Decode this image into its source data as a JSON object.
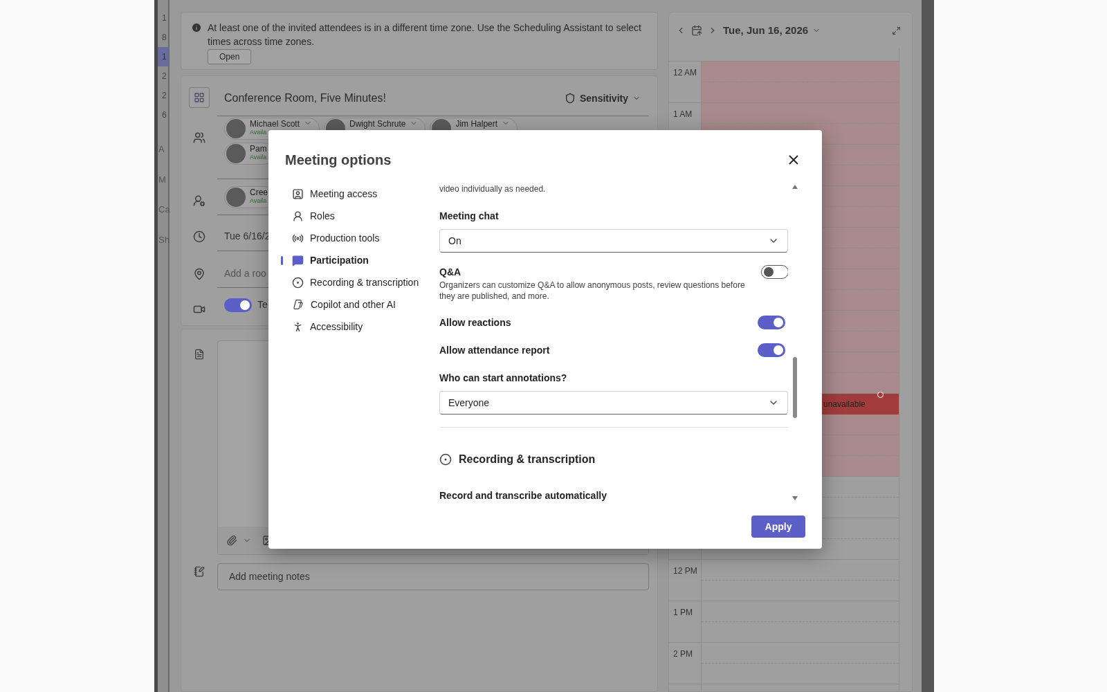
{
  "sidebar_strip": {
    "dates": [
      {
        "label": "1",
        "selected": false
      },
      {
        "label": "8",
        "selected": false
      },
      {
        "label": "1",
        "selected": true
      },
      {
        "label": "2",
        "selected": false
      },
      {
        "label": "2",
        "selected": false
      },
      {
        "label": "6",
        "selected": false
      }
    ],
    "labels": [
      "A",
      "M",
      "Ca",
      "Sh"
    ]
  },
  "notice": {
    "text": "At least one of the invited attendees is in a different time zone. Use the Scheduling Assistant to select times across time zones.",
    "button": "Open"
  },
  "form": {
    "title": "Conference Room, Five Minutes!",
    "sensitivity": "Sensitivity",
    "required_attendees": [
      {
        "name": "Michael Scott",
        "status": "Availa"
      },
      {
        "name": "Dwight Schrute"
      },
      {
        "name": "Jim Halpert"
      },
      {
        "name": "Pam",
        "status": "Availa"
      }
    ],
    "optional_attendees": [
      {
        "name": "Cree",
        "status": "Availa"
      }
    ],
    "date": "Tue 6/16/2",
    "location_placeholder": "Add a roo",
    "online_meeting": {
      "on": true,
      "label": "Te"
    },
    "notes_placeholder": "Add meeting notes"
  },
  "calendar": {
    "date": "Tue, Jun 16, 2026",
    "hours_top": [
      "12 AM",
      "1 AM"
    ],
    "hours_bottom": [
      "12 PM",
      "1 PM",
      "2 PM"
    ],
    "event": "unavailable"
  },
  "dialog": {
    "title": "Meeting options",
    "nav": [
      {
        "label": "Meeting access",
        "selected": false
      },
      {
        "label": "Roles",
        "selected": false
      },
      {
        "label": "Production tools",
        "selected": false
      },
      {
        "label": "Participation",
        "selected": true
      },
      {
        "label": "Recording & transcription",
        "selected": false
      },
      {
        "label": "Copilot and other AI",
        "selected": false
      },
      {
        "label": "Accessibility",
        "selected": false
      }
    ],
    "settings": [
      {
        "kind": "note",
        "text": "video individually as needed."
      },
      {
        "kind": "select",
        "label": "Meeting chat",
        "value": "On"
      },
      {
        "kind": "toggle",
        "label": "Q&A",
        "description": "Organizers can customize Q&A to allow anonymous posts, review questions before they are published, and more.",
        "on": false
      },
      {
        "kind": "toggle",
        "label": "Allow reactions",
        "on": true
      },
      {
        "kind": "toggle",
        "label": "Allow attendance report",
        "on": true
      },
      {
        "kind": "select",
        "label": "Who can start annotations?",
        "value": "Everyone"
      },
      {
        "kind": "divider"
      },
      {
        "kind": "section",
        "label": "Recording & transcription"
      },
      {
        "kind": "heading",
        "label": "Record and transcribe automatically"
      }
    ],
    "apply": "Apply"
  }
}
